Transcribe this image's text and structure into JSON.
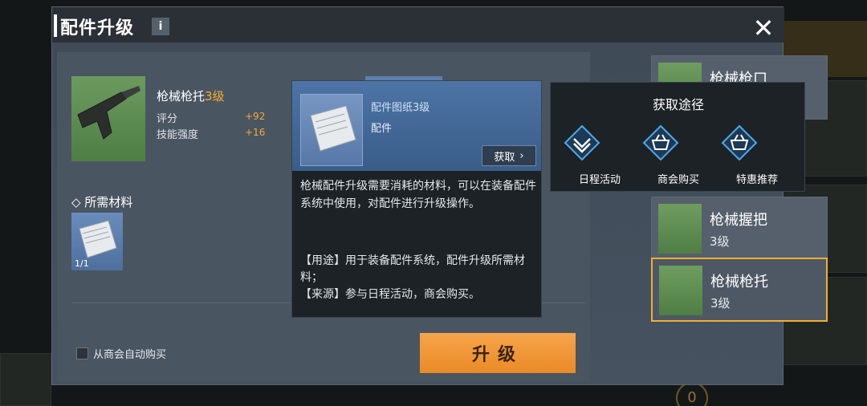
{
  "dialog": {
    "title": "配件升级",
    "info_icon": "i",
    "close_icon": "✕"
  },
  "part": {
    "name": "枪械枪托",
    "level": "3级",
    "stats": [
      {
        "label": "评分",
        "value": "+92"
      },
      {
        "label": "技能强度",
        "value": "+16"
      }
    ]
  },
  "materials": {
    "label": "◇ 所需材料",
    "count": "1/1"
  },
  "auto_buy": {
    "label": "从商会自动购买"
  },
  "upgrade_button": {
    "label": "升级"
  },
  "tooltip": {
    "item_name": "配件图纸3级",
    "item_type": "配件",
    "obtain_label": "获取",
    "description": "枪械配件升级需要消耗的材料，可以在装备配件系统中使用，对配件进行升级操作。",
    "usage": "【用途】用于装备配件系统，配件升级所需材料；",
    "source": "【来源】参与日程活动，商会购买。"
  },
  "obtain_popup": {
    "title": "获取途径",
    "options": [
      {
        "label": "日程活动",
        "icon": "schedule-icon"
      },
      {
        "label": "商会购买",
        "icon": "shop-basket-icon"
      },
      {
        "label": "特惠推荐",
        "icon": "deal-basket-icon"
      }
    ]
  },
  "part_list": [
    {
      "name": "枪械枪口",
      "level": ""
    },
    {
      "name": "枪械握把",
      "level": "3级"
    },
    {
      "name": "枪械枪托",
      "level": "3级",
      "selected": true
    }
  ],
  "colors": {
    "accent_orange": "#ea8a26",
    "level_gold": "#f5b02a",
    "selected_border": "#f0b030",
    "icon_blue": "#4fa8e8"
  }
}
